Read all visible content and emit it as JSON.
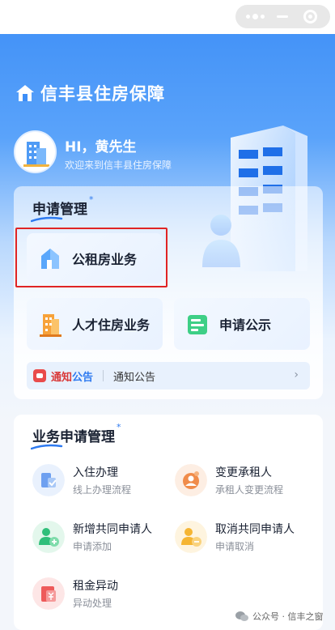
{
  "app": {
    "title": "信丰县住房保障"
  },
  "user": {
    "greeting": "HI，黄先生",
    "welcome": "欢迎来到信丰县住房保障"
  },
  "apply_section": {
    "title": "申请管理",
    "star": "*",
    "tiles": [
      {
        "label": "公租房业务",
        "highlighted": true
      },
      {
        "label": "人才住房业务"
      },
      {
        "label": "申请公示"
      }
    ],
    "notice": {
      "badge_part1": "通知",
      "badge_part2": "公告",
      "text": "通知公告",
      "arrow": "›"
    }
  },
  "business_section": {
    "title": "业务申请管理",
    "star": "*",
    "items": [
      {
        "name": "入住办理",
        "sub": "线上办理流程",
        "icon": "building-check-icon",
        "color": "#6ea0f0"
      },
      {
        "name": "变更承租人",
        "sub": "承租人变更流程",
        "icon": "person-change-icon",
        "color": "#f08c4a"
      },
      {
        "name": "新增共同申请人",
        "sub": "申请添加",
        "icon": "person-add-icon",
        "color": "#2fbf7a"
      },
      {
        "name": "取消共同申请人",
        "sub": "申请取消",
        "icon": "person-remove-icon",
        "color": "#f5b533"
      },
      {
        "name": "租金异动",
        "sub": "异动处理",
        "icon": "rent-icon",
        "color": "#ee5a5a"
      }
    ]
  },
  "watermark": {
    "text": "公众号 · 信丰之窗"
  },
  "colors": {
    "brand_blue": "#3d8ef7",
    "highlight_red": "#e02424"
  }
}
